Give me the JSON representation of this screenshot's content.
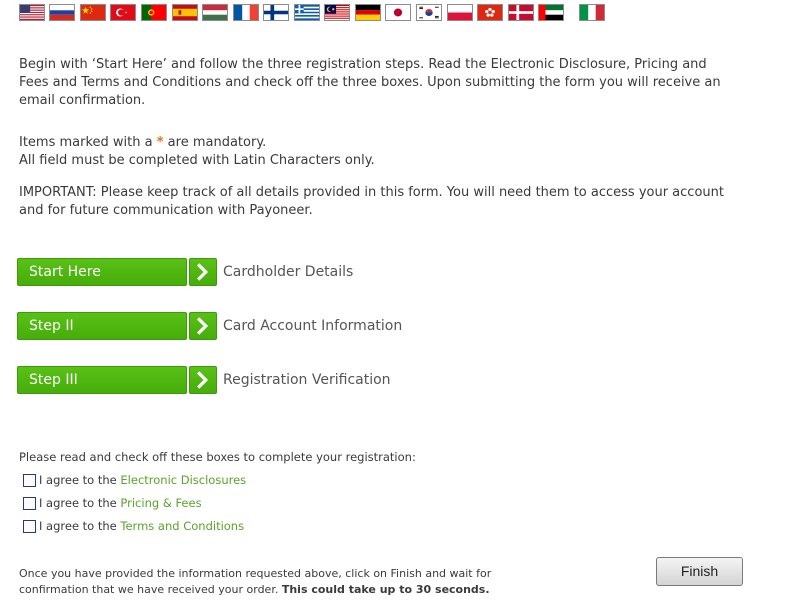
{
  "flags": [
    {
      "name": "us-flag",
      "country": "United States"
    },
    {
      "name": "ru-flag",
      "country": "Russia"
    },
    {
      "name": "cn-flag",
      "country": "China"
    },
    {
      "name": "tr-flag",
      "country": "Turkey"
    },
    {
      "name": "pt-flag",
      "country": "Portugal"
    },
    {
      "name": "es-flag",
      "country": "Spain"
    },
    {
      "name": "hu-flag",
      "country": "Hungary"
    },
    {
      "name": "fr-flag",
      "country": "France"
    },
    {
      "name": "fi-flag",
      "country": "Finland"
    },
    {
      "name": "gr-flag",
      "country": "Greece"
    },
    {
      "name": "my-flag",
      "country": "Malaysia"
    },
    {
      "name": "de-flag",
      "country": "Germany"
    },
    {
      "name": "jp-flag",
      "country": "Japan"
    },
    {
      "name": "kr-flag",
      "country": "South Korea"
    },
    {
      "name": "pl-flag",
      "country": "Poland"
    },
    {
      "name": "hk-flag",
      "country": "Hong Kong"
    },
    {
      "name": "dk-flag",
      "country": "Denmark"
    },
    {
      "name": "ae-flag",
      "country": "United Arab Emirates"
    },
    {
      "name": "it-flag",
      "country": "Italy"
    }
  ],
  "intro": "Begin with ‘Start Here’ and follow the three registration steps. Read the Electronic Disclosure, Pricing and Fees and Terms and Conditions and check off the three boxes. Upon submitting the form you will receive an email confirmation.",
  "mandatory": {
    "before": "Items marked with a ",
    "star": "*",
    "after": " are mandatory.",
    "latin": "All field must be completed with Latin Characters only."
  },
  "important": "IMPORTANT: Please keep track of all details provided in this form. You will need them to access your account and for future communication with Payoneer.",
  "steps": [
    {
      "button": "Start Here",
      "title": "Cardholder Details"
    },
    {
      "button": "Step II",
      "title": "Card Account Information"
    },
    {
      "button": "Step III",
      "title": "Registration Verification"
    }
  ],
  "agreements": {
    "heading": "Please read and check off these boxes to complete your registration:",
    "prefix": "I agree to the ",
    "items": [
      {
        "link": "Electronic Disclosures",
        "checked": false
      },
      {
        "link": "Pricing & Fees",
        "checked": false
      },
      {
        "link": "Terms and Conditions",
        "checked": false
      }
    ]
  },
  "note": {
    "text": "Once you have provided the information requested above, click on Finish and wait for confirmation that we have received your order. ",
    "bold": "This could take up to 30 seconds."
  },
  "finish_label": "Finish",
  "colors": {
    "accent": "#4db30e",
    "link": "#5aa32a",
    "star": "#e8730c"
  }
}
